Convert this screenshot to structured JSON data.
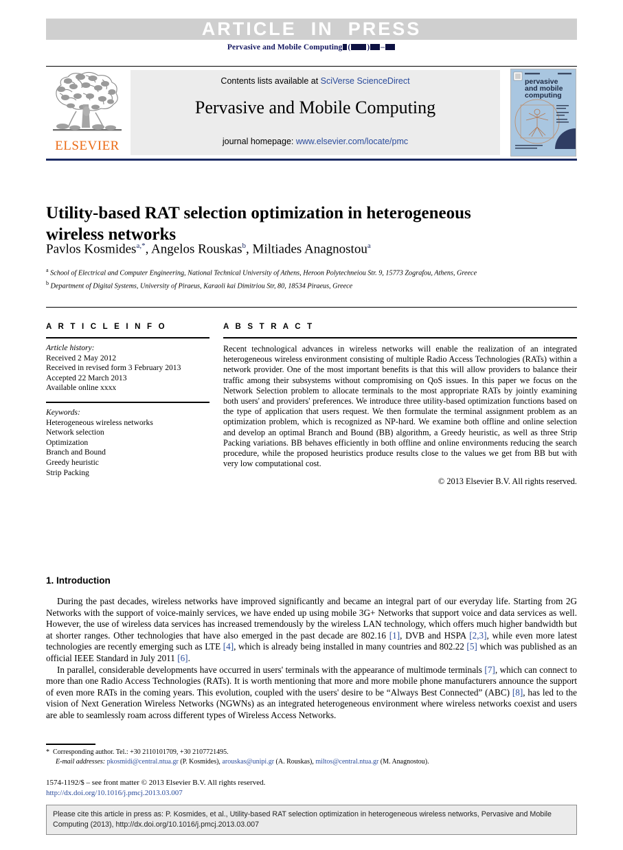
{
  "banner": {
    "article_in_press": "ARTICLE  IN  PRESS",
    "journal_ref_prefix": "Pervasive and Mobile Computing"
  },
  "masthead": {
    "contents_prefix": "Contents lists available at ",
    "contents_link": "SciVerse ScienceDirect",
    "journal_title": "Pervasive and Mobile Computing",
    "homepage_prefix": "journal homepage: ",
    "homepage_link": "www.elsevier.com/locate/pmc",
    "publisher": "ELSEVIER",
    "cover": {
      "line1": "pervasive",
      "line2": "and mobile",
      "line3": "computing"
    }
  },
  "article": {
    "title": "Utility-based RAT selection optimization in heterogeneous wireless networks",
    "authors": [
      {
        "name": "Pavlos Kosmides",
        "marks": "a,*"
      },
      {
        "name": "Angelos Rouskas",
        "marks": "b"
      },
      {
        "name": "Miltiades Anagnostou",
        "marks": "a"
      }
    ],
    "affiliations": [
      {
        "mark": "a",
        "text": "School of Electrical and Computer Engineering, National Technical University of Athens, Heroon Polytechneiou Str. 9, 15773 Zografou, Athens, Greece"
      },
      {
        "mark": "b",
        "text": "Department of Digital Systems, University of Piraeus, Karaoli kai Dimitriou Str, 80, 18534 Piraeus, Greece"
      }
    ]
  },
  "info": {
    "heading": "A R T I C L E   I N F O",
    "history_label": "Article history:",
    "history": [
      "Received 2 May 2012",
      "Received in revised form 3 February 2013",
      "Accepted 22 March 2013",
      "Available online xxxx"
    ],
    "keywords_label": "Keywords:",
    "keywords": [
      "Heterogeneous wireless networks",
      "Network selection",
      "Optimization",
      "Branch and Bound",
      "Greedy heuristic",
      "Strip Packing"
    ]
  },
  "abstract": {
    "heading": "A B S T R A C T",
    "text": "Recent technological advances in wireless networks will enable the realization of an integrated heterogeneous wireless environment consisting of multiple Radio Access Technologies (RATs) within a network provider. One of the most important benefits is that this will allow providers to balance their traffic among their subsystems without compromising on QoS issues. In this paper we focus on the Network Selection problem to allocate terminals to the most appropriate RATs by jointly examining both users' and providers' preferences. We introduce three utility-based optimization functions based on the type of application that users request. We then formulate the terminal assignment problem as an optimization problem, which is recognized as NP-hard. We examine both offline and online selection and develop an optimal Branch and Bound (BB) algorithm, a Greedy heuristic, as well as three Strip Packing variations. BB behaves efficiently in both offline and online environments reducing the search procedure, while the proposed heuristics produce results close to the values we get from BB but with very low computational cost.",
    "copyright": "© 2013 Elsevier B.V. All rights reserved."
  },
  "body": {
    "section_title": "1. Introduction",
    "paragraph1_a": "During the past decades, wireless networks have improved significantly and became an integral part of our everyday life. Starting from 2G Networks with the support of voice-mainly services, we have ended up using mobile 3G+ Networks that support voice and data services as well. However, the use of wireless data services has increased tremendously by the wireless LAN technology, which offers much higher bandwidth but at shorter ranges. Other technologies that have also emerged in the past decade are 802.16 ",
    "ref1": "[1]",
    "paragraph1_b": ", DVB and HSPA ",
    "ref23": "[2,3]",
    "paragraph1_c": ", while even more latest technologies are recently emerging such as LTE ",
    "ref4": "[4]",
    "paragraph1_d": ", which is already being installed in many countries and 802.22 ",
    "ref5": "[5]",
    "paragraph1_e": " which was published as an official IEEE Standard in July 2011 ",
    "ref6": "[6]",
    "paragraph1_f": ".",
    "paragraph2_a": "In parallel, considerable developments have occurred in users' terminals with the appearance of multimode terminals ",
    "ref7": "[7]",
    "paragraph2_b": ", which can connect to more than one Radio Access Technologies (RATs). It is worth mentioning that more and more mobile phone manufacturers announce the support of even more RATs in the coming years. This evolution, coupled with the users' desire to be “Always Best Connected” (ABC) ",
    "ref8": "[8]",
    "paragraph2_c": ", has led to the vision of Next Generation Wireless Networks (NGWNs) as an integrated heterogeneous environment where wireless networks coexist and users are able to seamlessly roam across different types of Wireless Access Networks."
  },
  "footnotes": {
    "corresponding": "Corresponding author. Tel.: +30 2110101709, +30 2107721495.",
    "email_label": "E-mail addresses:",
    "emails": [
      {
        "address": "pkosmidi@central.ntua.gr",
        "owner": " (P. Kosmides), "
      },
      {
        "address": "arouskas@unipi.gr",
        "owner": " (A. Rouskas), "
      },
      {
        "address": "miltos@central.ntua.gr",
        "owner": " (M. Anagnostou)."
      }
    ],
    "issn_line": "1574-1192/$ – see front matter © 2013 Elsevier B.V. All rights reserved.",
    "doi_line": "http://dx.doi.org/10.1016/j.pmcj.2013.03.007"
  },
  "cite_box": {
    "text": "Please cite this article in press as: P. Kosmides, et al., Utility-based RAT selection optimization in heterogeneous wireless networks, Pervasive and Mobile Computing (2013), http://dx.doi.org/10.1016/j.pmcj.2013.03.007"
  },
  "colors": {
    "link_blue": "#2a4b9b",
    "navy": "#11155e",
    "elsevier_orange": "#eb6b16",
    "banner_gray": "#cfcfcf",
    "box_gray": "#ececec"
  }
}
